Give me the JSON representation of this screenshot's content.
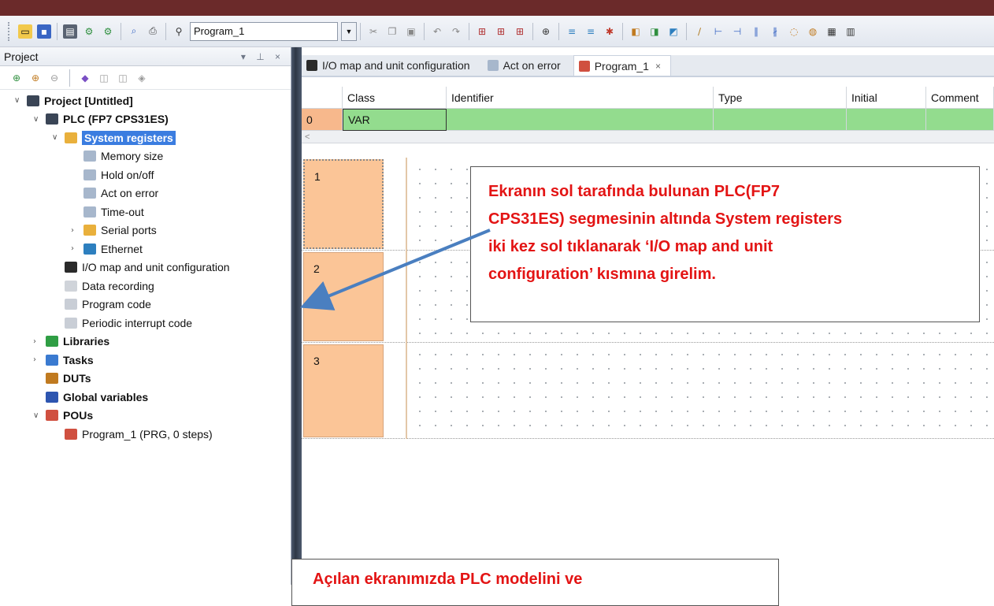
{
  "toolbar": {
    "program_combo": "Program_1",
    "icons": [
      "new-project-icon",
      "save-icon",
      "compile-icon",
      "online-icon",
      "offline-icon",
      "print-preview-icon",
      "print-icon",
      "find-icon",
      "cut-icon",
      "copy-icon",
      "paste-icon",
      "undo-icon",
      "redo-icon",
      "pou-icon",
      "monitor-icon",
      "contact-icon",
      "coil-icon",
      "function-icon"
    ]
  },
  "project_panel": {
    "title": "Project",
    "controls": "▾ ⊥ ×",
    "tree": [
      {
        "label": "Project [Untitled]",
        "bold": true,
        "expander": "∨",
        "level": 0,
        "icon": "project-icon"
      },
      {
        "label": "PLC (FP7 CPS31ES)",
        "bold": true,
        "expander": "∨",
        "level": 1,
        "icon": "plc-icon"
      },
      {
        "label": "System registers",
        "bold": true,
        "selected": true,
        "expander": "∨",
        "level": 2,
        "icon": "folder-wrench-icon"
      },
      {
        "label": "Memory size",
        "level": 3,
        "icon": "wrench-icon"
      },
      {
        "label": "Hold on/off",
        "level": 3,
        "icon": "wrench-icon"
      },
      {
        "label": "Act on error",
        "level": 3,
        "icon": "wrench-icon"
      },
      {
        "label": "Time-out",
        "level": 3,
        "icon": "wrench-icon"
      },
      {
        "label": "Serial ports",
        "expander": "›",
        "level": 3,
        "icon": "folder-icon"
      },
      {
        "label": "Ethernet",
        "expander": "›",
        "level": 3,
        "icon": "ethernet-icon"
      },
      {
        "label": "I/O map and unit configuration",
        "level": 2,
        "icon": "io-map-icon"
      },
      {
        "label": "Data recording",
        "level": 2,
        "icon": "record-icon"
      },
      {
        "label": "Program code",
        "level": 2,
        "icon": "code-icon"
      },
      {
        "label": "Periodic interrupt code",
        "level": 2,
        "icon": "code-icon"
      },
      {
        "label": "Libraries",
        "bold": true,
        "expander": "›",
        "level": 1,
        "icon": "library-icon"
      },
      {
        "label": "Tasks",
        "bold": true,
        "expander": "›",
        "level": 1,
        "icon": "tasks-icon"
      },
      {
        "label": "DUTs",
        "bold": true,
        "level": 1,
        "icon": "dut-icon"
      },
      {
        "label": "Global variables",
        "bold": true,
        "level": 1,
        "icon": "globals-icon"
      },
      {
        "label": "POUs",
        "bold": true,
        "expander": "∨",
        "level": 1,
        "icon": "pou-icon"
      },
      {
        "label": "Program_1 (PRG, 0 steps)",
        "level": 2,
        "icon": "program-icon"
      }
    ]
  },
  "tabs": [
    {
      "label": "I/O map and unit configuration",
      "icon": "io-map-icon",
      "active": false,
      "closable": false
    },
    {
      "label": "Act on error",
      "icon": "wrench-icon",
      "active": false,
      "closable": false
    },
    {
      "label": "Program_1",
      "icon": "program-icon",
      "active": true,
      "closable": true
    }
  ],
  "var_table": {
    "headers": [
      "",
      "Class",
      "Identifier",
      "Type",
      "Initial",
      "Comment"
    ],
    "rows": [
      [
        "0",
        "VAR",
        "",
        "",
        "",
        ""
      ]
    ],
    "scroll_hint": "<"
  },
  "ladder": {
    "rungs": [
      "1",
      "2",
      "3"
    ]
  },
  "annotations": {
    "callout_main": "Ekranın sol tarafında bulunan PLC(FP7 CPS31ES) segmesinin altında System registers iki kez sol tıklanarak ‘I/O map and unit configuration’ kısmına girelim.",
    "callout_main_lines": [
      "Ekranın sol tarafında bulunan PLC(FP7",
      "CPS31ES) segmesinin altında System registers",
      "iki kez sol tıklanarak ‘I/O map and unit",
      "configuration’ kısmına girelim."
    ],
    "callout_bottom": "Açılan ekranımızda PLC modelini ve"
  },
  "colors": {
    "selection": "#3b7de0",
    "var_row": "#93dc8e",
    "rung_number": "#fbc597",
    "callout_text": "#e31414",
    "arrow": "#4a7fc0"
  }
}
